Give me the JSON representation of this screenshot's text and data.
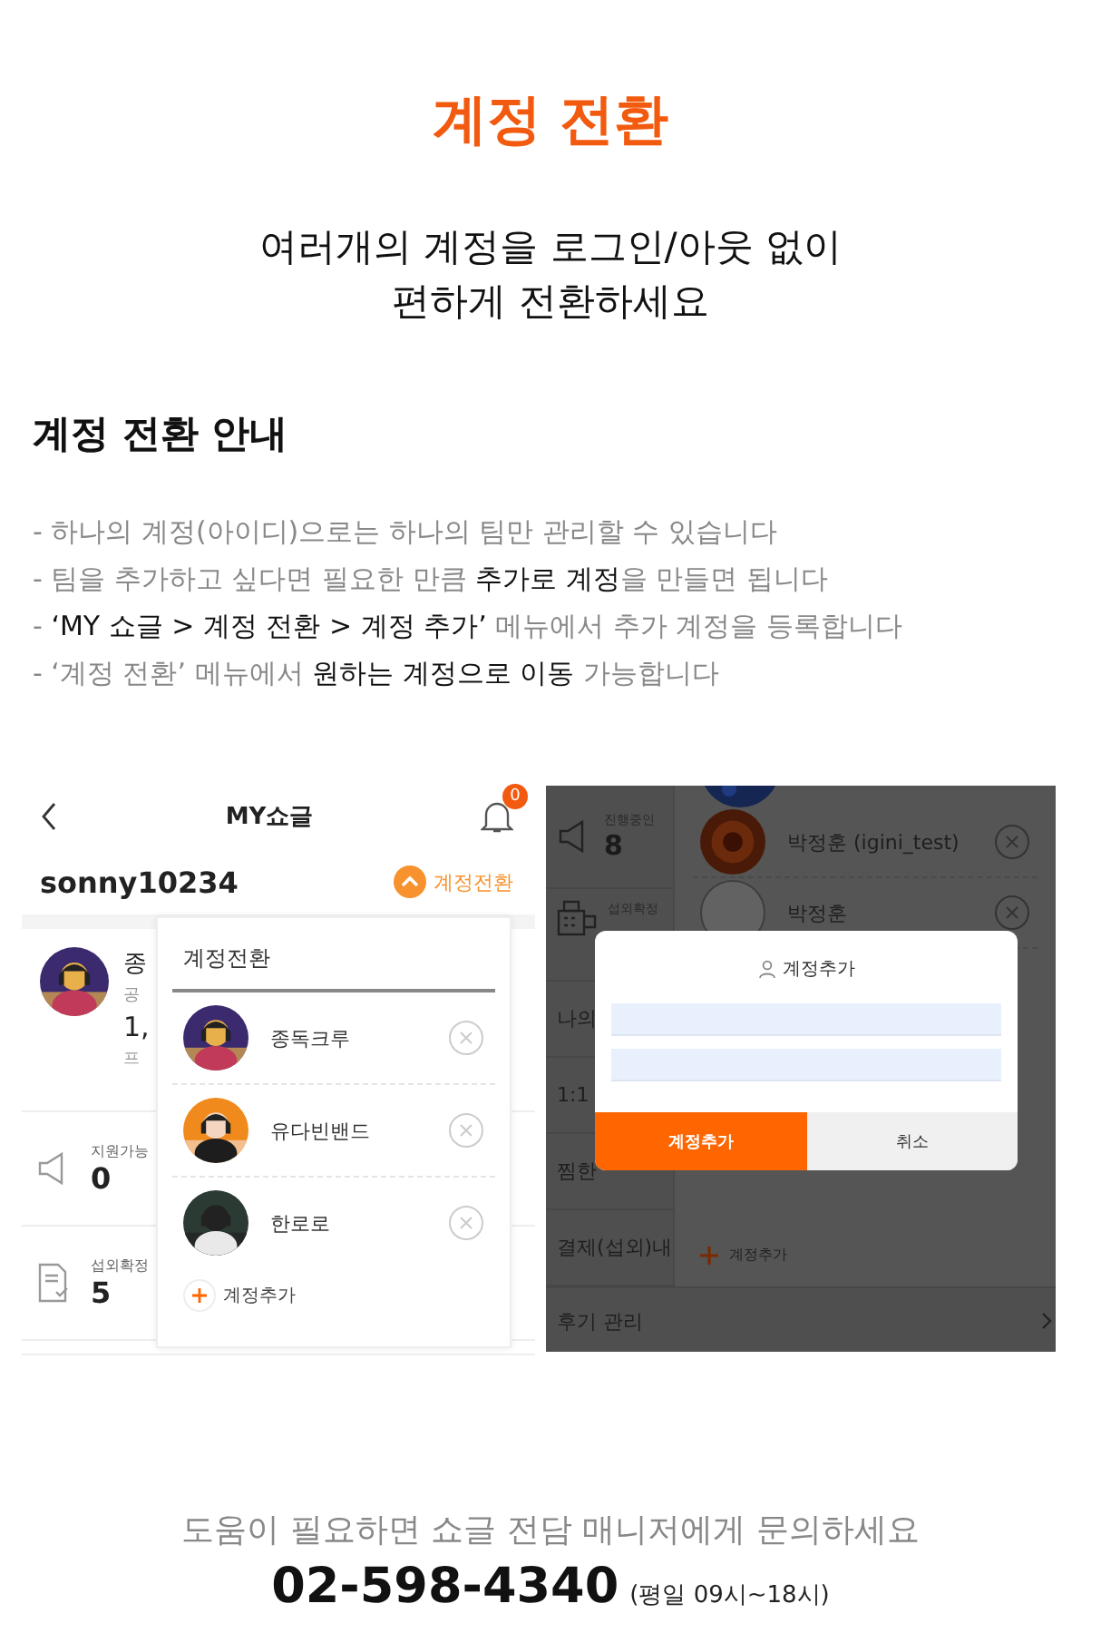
{
  "title": "계정 전환",
  "subtitle": [
    "여러개의 계정을 로그인/아웃 없이",
    "편하게 전환하세요"
  ],
  "guide": {
    "heading": "계정 전환 안내",
    "lines": [
      "- 하나의 계정(아이디)으로는 하나의 팀만 관리할 수 있습니다",
      "- 팀을 추가하고 싶다면 필요한 만큼 **추가로 계정**을 만들면 됩니다",
      "- **‘MY 쇼글 > 계정 전환 > 계정 추가’** 메뉴에서 추가 계정을 등록합니다",
      "- ‘계정 전환’ 메뉴에서 **원하는 계정으로 이동** 가능합니다"
    ]
  },
  "screen_1": {
    "header_title": "MY쇼글",
    "notification_count": "0",
    "username": "sonny10234",
    "switch_label": "계정전환",
    "profile": {
      "name": "종",
      "category": "공",
      "count": "1,",
      "link": "프"
    },
    "stats": [
      {
        "label": "지원가능",
        "value": "0",
        "kind": "megaphone"
      },
      {
        "label": "섭외확정",
        "value": "5",
        "kind": "document"
      }
    ],
    "dropdown": {
      "title": "계정전환",
      "accounts": [
        {
          "name": "종독크루"
        },
        {
          "name": "유다빈밴드"
        },
        {
          "name": "한로로"
        }
      ],
      "add_label": "계정추가"
    }
  },
  "screen_2": {
    "stats": [
      {
        "label": "진행중인",
        "value": "8",
        "kind": "megaphone"
      },
      {
        "label": "섭외확정",
        "kind": "register"
      }
    ],
    "menu": [
      "나의",
      "1:1",
      "찜한",
      "결제(섭외)내"
    ],
    "accounts": [
      {
        "name": "박정훈 (igini_test)"
      },
      {
        "name": "박정훈"
      }
    ],
    "add_label": "계정추가",
    "bottom_item": "후기 관리",
    "dialog": {
      "title": "계정추가",
      "buttons": [
        {
          "label": "계정추가",
          "kind": "primary"
        },
        {
          "label": "취소",
          "kind": "secondary"
        }
      ]
    }
  },
  "footer": {
    "help": "도움이 필요하면 쇼글 전담 매니저에게 문의하세요",
    "phone": "02-598-4340",
    "hours": "(평일 09시~18시)"
  }
}
